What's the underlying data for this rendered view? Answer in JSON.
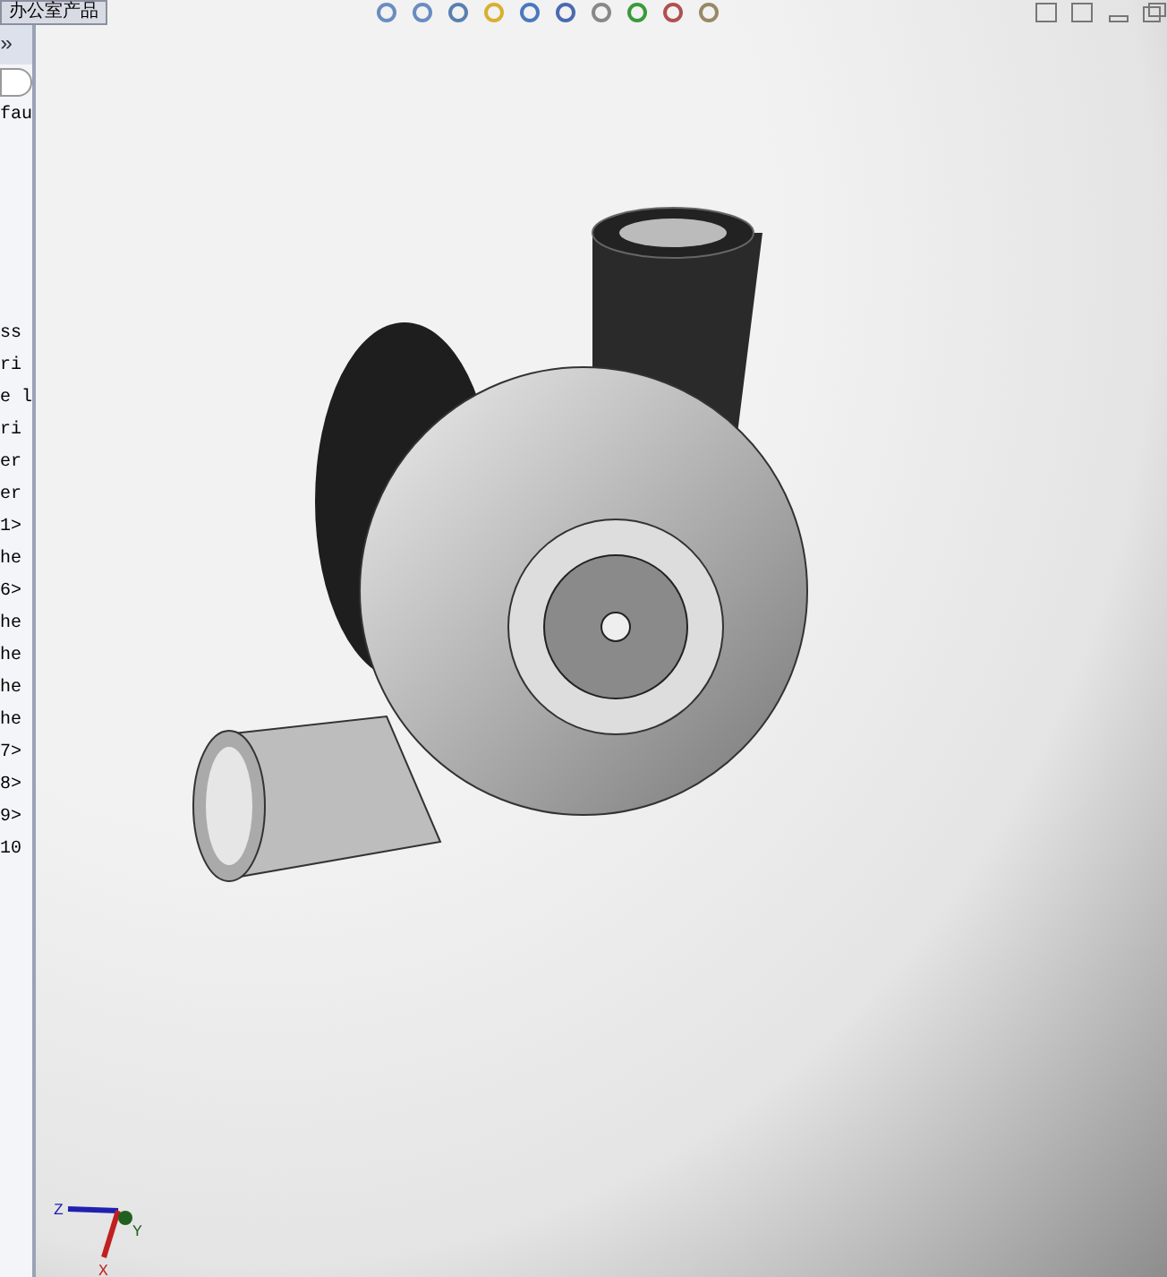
{
  "top_tab": {
    "label": "办公室产品"
  },
  "panel": {
    "expand_glyph": "»",
    "config_text": "fau",
    "tree_items": [
      "ss",
      "ri",
      "e l",
      "ri",
      "er",
      "er",
      "1>",
      "he",
      "6>",
      "he",
      "he",
      "he",
      "he",
      "7>",
      "8>",
      "9>",
      "10"
    ]
  },
  "triad": {
    "x": "X",
    "y": "Y",
    "z": "Z"
  }
}
